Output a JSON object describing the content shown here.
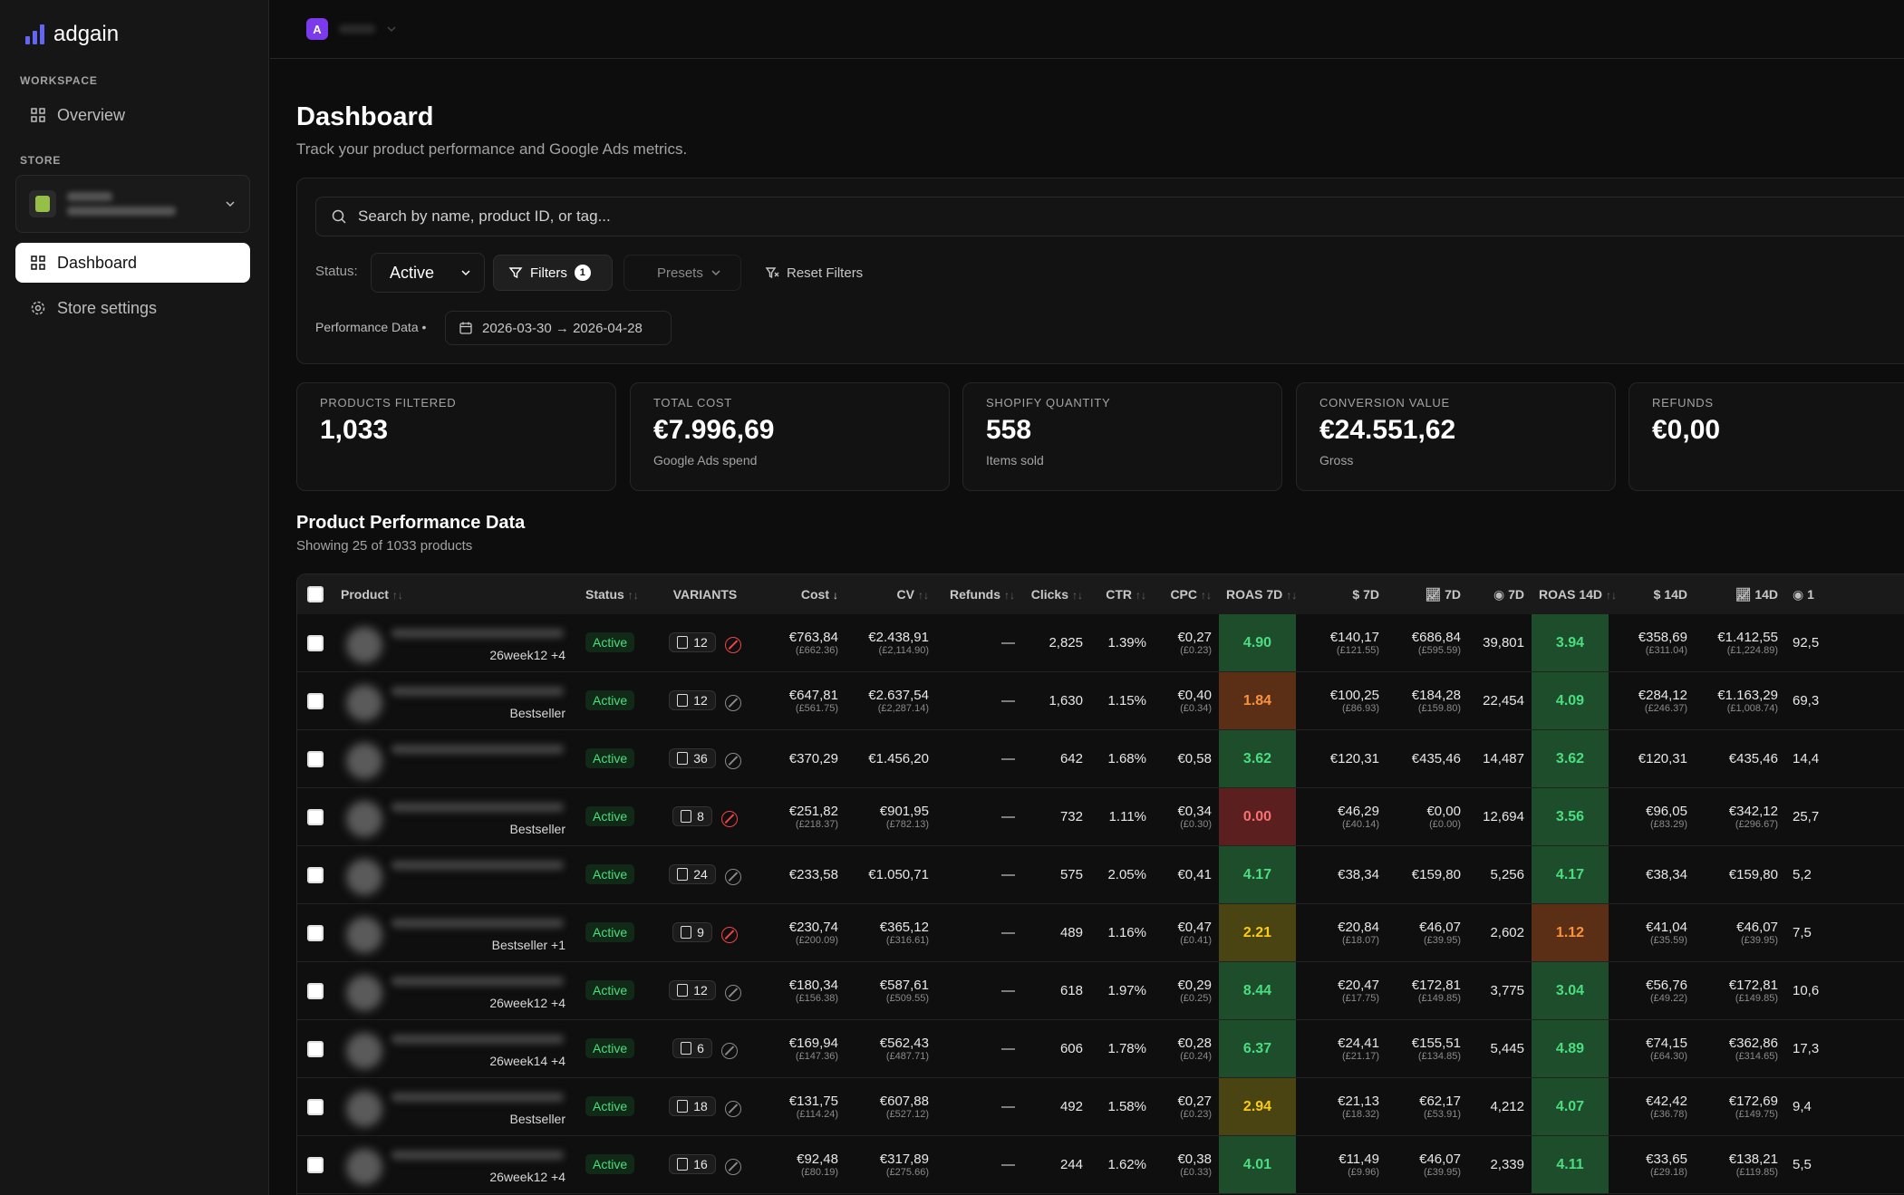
{
  "app": {
    "name": "adgain"
  },
  "sidebar": {
    "workspace_label": "WORKSPACE",
    "store_label": "STORE",
    "items": [
      {
        "label": "Overview",
        "icon": "grid-icon"
      },
      {
        "label": "Dashboard",
        "icon": "grid-icon",
        "active": true
      },
      {
        "label": "Store settings",
        "icon": "gear-icon"
      }
    ]
  },
  "topbar": {
    "workspace_initial": "A"
  },
  "header": {
    "title": "Dashboard",
    "subtitle": "Track your product performance and Google Ads metrics."
  },
  "filters": {
    "search_placeholder": "Search by name, product ID, or tag...",
    "status_label": "Status:",
    "status_value": "Active",
    "filters_label": "Filters",
    "filters_count": "1",
    "presets_label": "Presets",
    "reset_label": "Reset Filters",
    "performance_label": "Performance Data •",
    "date_range": "2026-03-30 → 2026-04-28"
  },
  "stats": [
    {
      "label": "PRODUCTS FILTERED",
      "value": "1,033",
      "sub": ""
    },
    {
      "label": "TOTAL COST",
      "value": "€7.996,69",
      "sub": "Google Ads spend"
    },
    {
      "label": "SHOPIFY QUANTITY",
      "value": "558",
      "sub": "Items sold"
    },
    {
      "label": "CONVERSION VALUE",
      "value": "€24.551,62",
      "sub": "Gross"
    },
    {
      "label": "REFUNDS",
      "value": "€0,00",
      "sub": ""
    }
  ],
  "table": {
    "title": "Product Performance Data",
    "subtitle": "Showing 25 of 1033 products",
    "headers": {
      "product": "Product",
      "status": "Status",
      "variants": "VARIANTS",
      "cost": "Cost",
      "cv": "CV",
      "refunds": "Refunds",
      "clicks": "Clicks",
      "ctr": "CTR",
      "cpc": "CPC",
      "roas7": "ROAS 7D",
      "usd7": "$ 7D",
      "chart7": "7D",
      "eye7": "7D",
      "roas14": "ROAS 14D",
      "usd14": "$ 14D",
      "chart14": "14D",
      "eye14": "1"
    },
    "rows": [
      {
        "tag": "26week12 +4",
        "status": "Active",
        "variants": "12",
        "ban": "red",
        "cost": "€763,84",
        "cost_sub": "(£662.36)",
        "cv": "€2.438,91",
        "cv_sub": "(£2,114.90)",
        "refunds": "—",
        "clicks": "2,825",
        "ctr": "1.39%",
        "cpc": "€0,27",
        "cpc_sub": "(£0.23)",
        "roas7": "4.90",
        "roas7_color": "green",
        "usd7": "€140,17",
        "usd7_sub": "(£121.55)",
        "chart7": "€686,84",
        "chart7_sub": "(£595.59)",
        "eye7": "39,801",
        "roas14": "3.94",
        "roas14_color": "green",
        "usd14": "€358,69",
        "usd14_sub": "(£311.04)",
        "chart14": "€1.412,55",
        "chart14_sub": "(£1,224.89)",
        "eye14": "92,5"
      },
      {
        "tag": "Bestseller",
        "status": "Active",
        "variants": "12",
        "ban": "grey",
        "cost": "€647,81",
        "cost_sub": "(£561.75)",
        "cv": "€2.637,54",
        "cv_sub": "(£2,287.14)",
        "refunds": "—",
        "clicks": "1,630",
        "ctr": "1.15%",
        "cpc": "€0,40",
        "cpc_sub": "(£0.34)",
        "roas7": "1.84",
        "roas7_color": "orange",
        "usd7": "€100,25",
        "usd7_sub": "(£86.93)",
        "chart7": "€184,28",
        "chart7_sub": "(£159.80)",
        "eye7": "22,454",
        "roas14": "4.09",
        "roas14_color": "green",
        "usd14": "€284,12",
        "usd14_sub": "(£246.37)",
        "chart14": "€1.163,29",
        "chart14_sub": "(£1,008.74)",
        "eye14": "69,3"
      },
      {
        "tag": "",
        "status": "Active",
        "variants": "36",
        "ban": "grey",
        "cost": "€370,29",
        "cost_sub": "",
        "cv": "€1.456,20",
        "cv_sub": "",
        "refunds": "—",
        "clicks": "642",
        "ctr": "1.68%",
        "cpc": "€0,58",
        "cpc_sub": "",
        "roas7": "3.62",
        "roas7_color": "green",
        "usd7": "€120,31",
        "usd7_sub": "",
        "chart7": "€435,46",
        "chart7_sub": "",
        "eye7": "14,487",
        "roas14": "3.62",
        "roas14_color": "green",
        "usd14": "€120,31",
        "usd14_sub": "",
        "chart14": "€435,46",
        "chart14_sub": "",
        "eye14": "14,4"
      },
      {
        "tag": "Bestseller",
        "status": "Active",
        "variants": "8",
        "ban": "red",
        "cost": "€251,82",
        "cost_sub": "(£218.37)",
        "cv": "€901,95",
        "cv_sub": "(£782.13)",
        "refunds": "—",
        "clicks": "732",
        "ctr": "1.11%",
        "cpc": "€0,34",
        "cpc_sub": "(£0.30)",
        "roas7": "0.00",
        "roas7_color": "red",
        "usd7": "€46,29",
        "usd7_sub": "(£40.14)",
        "chart7": "€0,00",
        "chart7_sub": "(£0.00)",
        "eye7": "12,694",
        "roas14": "3.56",
        "roas14_color": "green",
        "usd14": "€96,05",
        "usd14_sub": "(£83.29)",
        "chart14": "€342,12",
        "chart14_sub": "(£296.67)",
        "eye14": "25,7"
      },
      {
        "tag": "",
        "status": "Active",
        "variants": "24",
        "ban": "grey",
        "cost": "€233,58",
        "cost_sub": "",
        "cv": "€1.050,71",
        "cv_sub": "",
        "refunds": "—",
        "clicks": "575",
        "ctr": "2.05%",
        "cpc": "€0,41",
        "cpc_sub": "",
        "roas7": "4.17",
        "roas7_color": "green",
        "usd7": "€38,34",
        "usd7_sub": "",
        "chart7": "€159,80",
        "chart7_sub": "",
        "eye7": "5,256",
        "roas14": "4.17",
        "roas14_color": "green",
        "usd14": "€38,34",
        "usd14_sub": "",
        "chart14": "€159,80",
        "chart14_sub": "",
        "eye14": "5,2"
      },
      {
        "tag": "Bestseller +1",
        "status": "Active",
        "variants": "9",
        "ban": "red",
        "cost": "€230,74",
        "cost_sub": "(£200.09)",
        "cv": "€365,12",
        "cv_sub": "(£316.61)",
        "refunds": "—",
        "clicks": "489",
        "ctr": "1.16%",
        "cpc": "€0,47",
        "cpc_sub": "(£0.41)",
        "roas7": "2.21",
        "roas7_color": "yellow",
        "usd7": "€20,84",
        "usd7_sub": "(£18.07)",
        "chart7": "€46,07",
        "chart7_sub": "(£39.95)",
        "eye7": "2,602",
        "roas14": "1.12",
        "roas14_color": "orange",
        "usd14": "€41,04",
        "usd14_sub": "(£35.59)",
        "chart14": "€46,07",
        "chart14_sub": "(£39.95)",
        "eye14": "7,5"
      },
      {
        "tag": "26week12 +4",
        "status": "Active",
        "variants": "12",
        "ban": "grey",
        "cost": "€180,34",
        "cost_sub": "(£156.38)",
        "cv": "€587,61",
        "cv_sub": "(£509.55)",
        "refunds": "—",
        "clicks": "618",
        "ctr": "1.97%",
        "cpc": "€0,29",
        "cpc_sub": "(£0.25)",
        "roas7": "8.44",
        "roas7_color": "green",
        "usd7": "€20,47",
        "usd7_sub": "(£17.75)",
        "chart7": "€172,81",
        "chart7_sub": "(£149.85)",
        "eye7": "3,775",
        "roas14": "3.04",
        "roas14_color": "green",
        "usd14": "€56,76",
        "usd14_sub": "(£49.22)",
        "chart14": "€172,81",
        "chart14_sub": "(£149.85)",
        "eye14": "10,6"
      },
      {
        "tag": "26week14 +4",
        "status": "Active",
        "variants": "6",
        "ban": "grey",
        "cost": "€169,94",
        "cost_sub": "(£147.36)",
        "cv": "€562,43",
        "cv_sub": "(£487.71)",
        "refunds": "—",
        "clicks": "606",
        "ctr": "1.78%",
        "cpc": "€0,28",
        "cpc_sub": "(£0.24)",
        "roas7": "6.37",
        "roas7_color": "green",
        "usd7": "€24,41",
        "usd7_sub": "(£21.17)",
        "chart7": "€155,51",
        "chart7_sub": "(£134.85)",
        "eye7": "5,445",
        "roas14": "4.89",
        "roas14_color": "green",
        "usd14": "€74,15",
        "usd14_sub": "(£64.30)",
        "chart14": "€362,86",
        "chart14_sub": "(£314.65)",
        "eye14": "17,3"
      },
      {
        "tag": "Bestseller",
        "status": "Active",
        "variants": "18",
        "ban": "grey",
        "cost": "€131,75",
        "cost_sub": "(£114.24)",
        "cv": "€607,88",
        "cv_sub": "(£527.12)",
        "refunds": "—",
        "clicks": "492",
        "ctr": "1.58%",
        "cpc": "€0,27",
        "cpc_sub": "(£0.23)",
        "roas7": "2.94",
        "roas7_color": "yellow",
        "usd7": "€21,13",
        "usd7_sub": "(£18.32)",
        "chart7": "€62,17",
        "chart7_sub": "(£53.91)",
        "eye7": "4,212",
        "roas14": "4.07",
        "roas14_color": "green",
        "usd14": "€42,42",
        "usd14_sub": "(£36.78)",
        "chart14": "€172,69",
        "chart14_sub": "(£149.75)",
        "eye14": "9,4"
      },
      {
        "tag": "26week12 +4",
        "status": "Active",
        "variants": "16",
        "ban": "grey",
        "cost": "€92,48",
        "cost_sub": "(£80.19)",
        "cv": "€317,89",
        "cv_sub": "(£275.66)",
        "refunds": "—",
        "clicks": "244",
        "ctr": "1.62%",
        "cpc": "€0,38",
        "cpc_sub": "(£0.33)",
        "roas7": "4.01",
        "roas7_color": "green",
        "usd7": "€11,49",
        "usd7_sub": "(£9.96)",
        "chart7": "€46,07",
        "chart7_sub": "(£39.95)",
        "eye7": "2,339",
        "roas14": "4.11",
        "roas14_color": "green",
        "usd14": "€33,65",
        "usd14_sub": "(£29.18)",
        "chart14": "€138,21",
        "chart14_sub": "(£119.85)",
        "eye14": "5,5"
      }
    ]
  }
}
